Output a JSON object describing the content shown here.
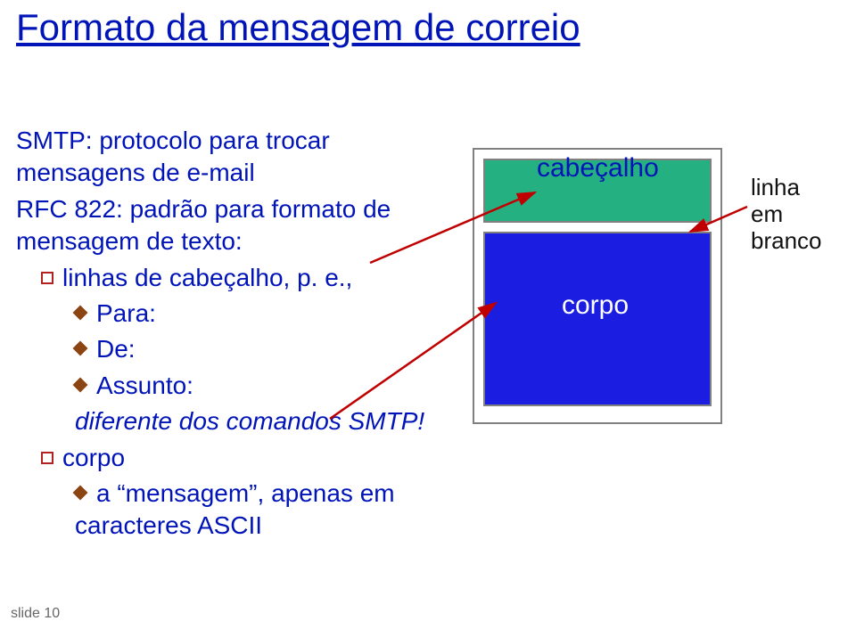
{
  "title": "Formato da mensagem de correio",
  "left": {
    "line1": "SMTP: protocolo para trocar mensagens de e-mail",
    "line2": "RFC 822: padrão para formato de mensagem de texto:",
    "bul1": "linhas de cabeçalho, p. e.,",
    "sub1": "Para:",
    "sub2": "De:",
    "sub3": "Assunto:",
    "note": "diferente dos comandos SMTP!",
    "bul2": "corpo",
    "sub4": "a “mensagem”, apenas em caracteres ASCII"
  },
  "labels": {
    "header": "cabeçalho",
    "body": "corpo",
    "blank1": "linha",
    "blank2": "em",
    "blank3": "branco"
  },
  "footer": "slide 10"
}
